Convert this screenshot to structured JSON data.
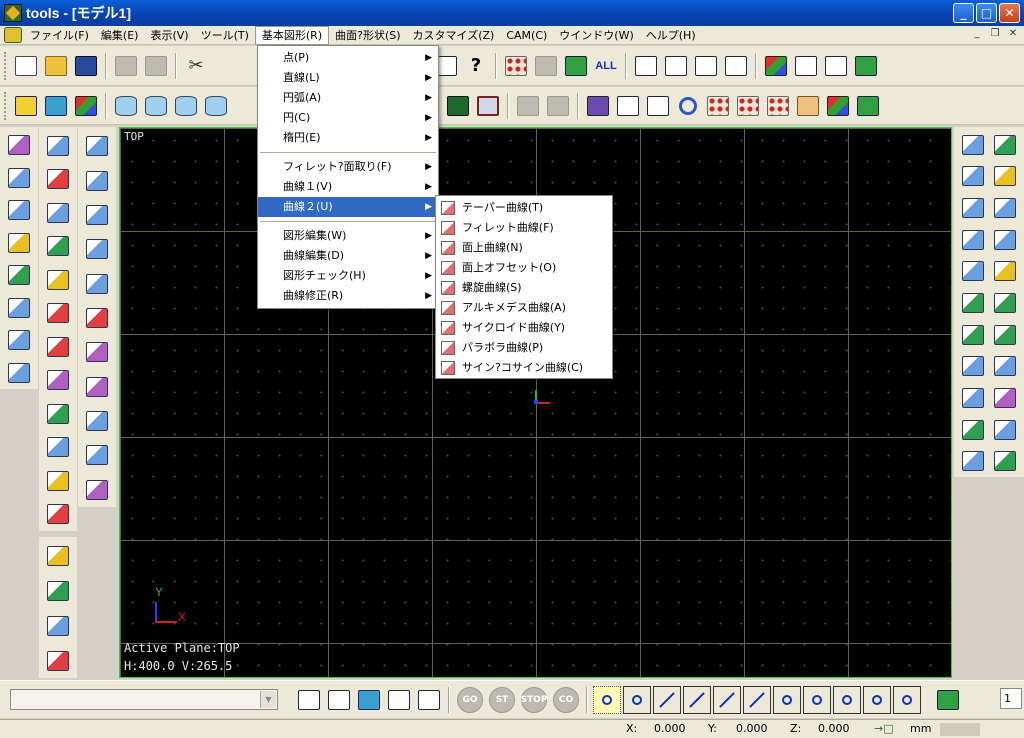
{
  "window": {
    "title": "tools - [モデル1]",
    "minimize": "_",
    "maximize": "□",
    "close": "✕"
  },
  "menubar": {
    "items": [
      "ファイル(F)",
      "編集(E)",
      "表示(V)",
      "ツール(T)",
      "基本図形(R)",
      "曲面?形状(S)",
      "カスタマイズ(Z)",
      "CAM(C)",
      "ウインドウ(W)",
      "ヘルプ(H)"
    ],
    "active_index": 4,
    "mdi": {
      "minimize": "_",
      "restore": "❐",
      "close": "✕"
    }
  },
  "toolbar1": {
    "all_label": "ALL",
    "help_label": "?"
  },
  "menu_basic_shapes": {
    "items": [
      {
        "label": "点(P)",
        "submenu": true
      },
      {
        "label": "直線(L)",
        "submenu": true
      },
      {
        "label": "円弧(A)",
        "submenu": true
      },
      {
        "label": "円(C)",
        "submenu": true
      },
      {
        "label": "楕円(E)",
        "submenu": true
      },
      {
        "label": "フィレット?面取り(F)",
        "submenu": true
      },
      {
        "label": "曲線１(V)",
        "submenu": true
      },
      {
        "label": "曲線２(U)",
        "submenu": true,
        "highlighted": true
      },
      {
        "label": "図形編集(W)",
        "submenu": true
      },
      {
        "label": "曲線編集(D)",
        "submenu": true
      },
      {
        "label": "図形チェック(H)",
        "submenu": true
      },
      {
        "label": "曲線修正(R)",
        "submenu": true
      }
    ]
  },
  "menu_curve2": {
    "items": [
      "テーパー曲線(T)",
      "フィレット曲線(F)",
      "面上曲線(N)",
      "面上オフセット(O)",
      "螺旋曲線(S)",
      "アルキメデス曲線(A)",
      "サイクロイド曲線(Y)",
      "パラボラ曲線(P)",
      "サイン?コサイン曲線(C)"
    ]
  },
  "viewport": {
    "view_name": "TOP",
    "active_plane": "Active Plane:TOP",
    "hv": "H:400.0 V:265.5",
    "axis_x": "X",
    "axis_y": "Y",
    "grid_color": "#5a6a3a",
    "border_color": "#39c839"
  },
  "bottombar": {
    "stop_buttons": [
      "GO",
      "ST",
      "STOP",
      "CO"
    ],
    "number_box": "1"
  },
  "status": {
    "x_label": "X:",
    "x_value": "0.000",
    "y_label": "Y:",
    "y_value": "0.000",
    "z_label": "Z:",
    "z_value": "0.000",
    "unit": "mm"
  },
  "colors": {
    "menu_highlight": "#316ac5",
    "titlebar": "#0a5fd8"
  }
}
